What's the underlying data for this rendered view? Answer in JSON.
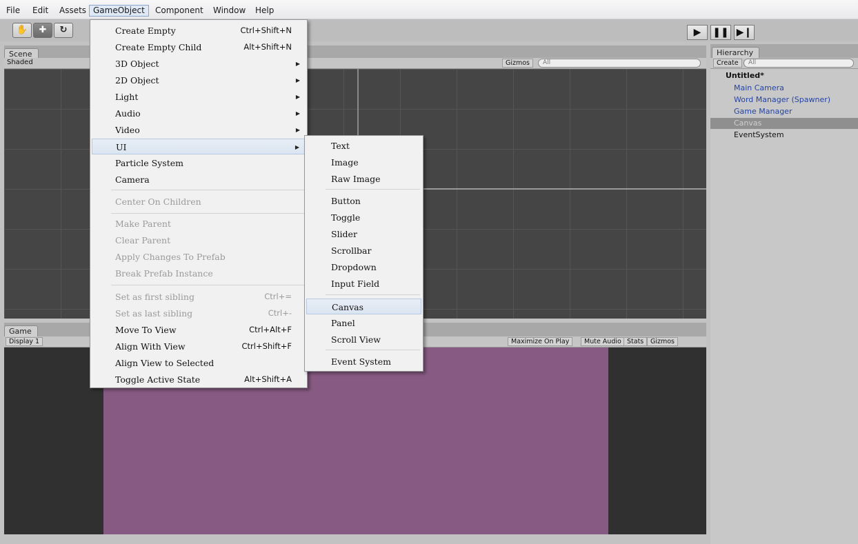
{
  "menubar": {
    "items": [
      "File",
      "Edit",
      "Assets",
      "GameObject",
      "Component",
      "Window",
      "Help"
    ],
    "active": "GameObject"
  },
  "toolbar": {
    "tools": [
      "hand-tool-icon",
      "move-tool-icon",
      "rotate-tool-icon"
    ],
    "play": [
      "play-icon",
      "pause-icon",
      "step-icon"
    ]
  },
  "scene": {
    "tab_label": "Scene",
    "shading": "Shaded",
    "gizmos": "Gizmos",
    "search": "All"
  },
  "game": {
    "tab_label": "Game",
    "display": "Display 1",
    "options": [
      "Maximize On Play",
      "Mute Audio",
      "Stats",
      "Gizmos"
    ]
  },
  "hierarchy": {
    "tab_label": "Hierarchy",
    "create": "Create",
    "search": "All",
    "scene_name": "Untitled*",
    "items": [
      {
        "label": "Main Camera",
        "style": "blue"
      },
      {
        "label": "Word Manager (Spawner)",
        "style": "blue"
      },
      {
        "label": "Game Manager",
        "style": "blue"
      },
      {
        "label": "Canvas",
        "style": "selected"
      },
      {
        "label": "EventSystem",
        "style": "normal"
      }
    ]
  },
  "gameobject_menu": {
    "items": [
      {
        "label": "Create Empty",
        "shortcut": "Ctrl+Shift+N"
      },
      {
        "label": "Create Empty Child",
        "shortcut": "Alt+Shift+N"
      },
      {
        "label": "3D Object",
        "submenu": true
      },
      {
        "label": "2D Object",
        "submenu": true
      },
      {
        "label": "Light",
        "submenu": true
      },
      {
        "label": "Audio",
        "submenu": true
      },
      {
        "label": "Video",
        "submenu": true
      },
      {
        "label": "UI",
        "submenu": true,
        "highlight": true
      },
      {
        "label": "Particle System"
      },
      {
        "label": "Camera"
      },
      {
        "label": "Center On Children",
        "disabled": true
      },
      {
        "label": "Make Parent",
        "disabled": true
      },
      {
        "label": "Clear Parent",
        "disabled": true
      },
      {
        "label": "Apply Changes To Prefab",
        "disabled": true
      },
      {
        "label": "Break Prefab Instance",
        "disabled": true
      },
      {
        "label": "Set as first sibling",
        "shortcut": "Ctrl+=",
        "disabled": true
      },
      {
        "label": "Set as last sibling",
        "shortcut": "Ctrl+-",
        "disabled": true
      },
      {
        "label": "Move To View",
        "shortcut": "Ctrl+Alt+F"
      },
      {
        "label": "Align With View",
        "shortcut": "Ctrl+Shift+F"
      },
      {
        "label": "Align View to Selected"
      },
      {
        "label": "Toggle Active State",
        "shortcut": "Alt+Shift+A"
      }
    ]
  },
  "ui_submenu": {
    "items": [
      {
        "label": "Text"
      },
      {
        "label": "Image"
      },
      {
        "label": "Raw Image"
      },
      {
        "label": "Button"
      },
      {
        "label": "Toggle"
      },
      {
        "label": "Slider"
      },
      {
        "label": "Scrollbar"
      },
      {
        "label": "Dropdown"
      },
      {
        "label": "Input Field"
      },
      {
        "label": "Canvas",
        "highlight": true
      },
      {
        "label": "Panel"
      },
      {
        "label": "Scroll View"
      },
      {
        "label": "Event System"
      }
    ]
  }
}
